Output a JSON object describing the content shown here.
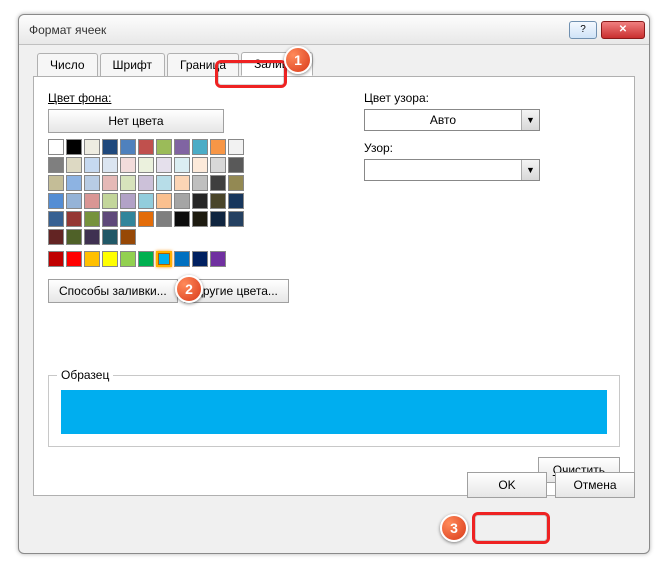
{
  "window": {
    "title": "Формат ячеек"
  },
  "tabs": {
    "number": "Число",
    "font": "Шрифт",
    "border": "Граница",
    "fill": "Заливка"
  },
  "fill": {
    "bg_label": "Цвет фона:",
    "nocolor": "Нет цвета",
    "fill_effects": "Способы заливки...",
    "more_colors": "Другие цвета...",
    "pattern_color_label": "Цвет узора:",
    "pattern_color_value": "Авто",
    "pattern_label": "Узор:",
    "sample_label": "Образец",
    "sample_color": "#00aeef",
    "clear": "Очистить"
  },
  "theme_colors": [
    [
      "#ffffff",
      "#000000",
      "#eeece1",
      "#1f497d",
      "#4f81bd",
      "#c0504d",
      "#9bbb59",
      "#8064a2",
      "#4bacc6",
      "#f79646"
    ],
    [
      "#f2f2f2",
      "#7f7f7f",
      "#ddd9c3",
      "#c6d9f0",
      "#dbe5f1",
      "#f2dcdb",
      "#ebf1dd",
      "#e5e0ec",
      "#dbeef3",
      "#fdeada"
    ],
    [
      "#d8d8d8",
      "#595959",
      "#c4bd97",
      "#8db3e2",
      "#b8cce4",
      "#e5b9b7",
      "#d7e3bc",
      "#ccc1d9",
      "#b7dde8",
      "#fbd5b5"
    ],
    [
      "#bfbfbf",
      "#3f3f3f",
      "#938953",
      "#548dd4",
      "#95b3d7",
      "#d99694",
      "#c3d69b",
      "#b2a2c7",
      "#92cddc",
      "#fac08f"
    ],
    [
      "#a5a5a5",
      "#262626",
      "#494429",
      "#17365d",
      "#366092",
      "#953734",
      "#76923c",
      "#5f497a",
      "#31859b",
      "#e36c09"
    ],
    [
      "#7f7f7f",
      "#0c0c0c",
      "#1d1b10",
      "#0f243e",
      "#244061",
      "#632423",
      "#4f6128",
      "#3f3151",
      "#205867",
      "#974806"
    ]
  ],
  "standard_colors": [
    "#c00000",
    "#ff0000",
    "#ffc000",
    "#ffff00",
    "#92d050",
    "#00b050",
    "#00b0f0",
    "#0070c0",
    "#002060",
    "#7030a0"
  ],
  "selected_standard_index": 6,
  "footer": {
    "ok": "OK",
    "cancel": "Отмена"
  },
  "callouts": {
    "c1": "1",
    "c2": "2",
    "c3": "3"
  }
}
